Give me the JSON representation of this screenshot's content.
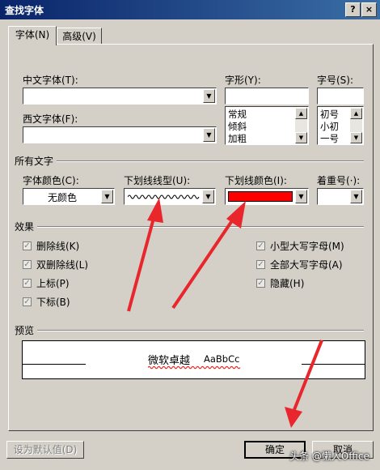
{
  "window": {
    "title": "查找字体",
    "help_btn": "?",
    "close_btn": "×"
  },
  "tabs": [
    {
      "label": "字体(N)"
    },
    {
      "label": "高级(V)"
    }
  ],
  "fonts": {
    "chinese_font_label": "中文字体(T):",
    "chinese_font_value": "",
    "western_font_label": "西文字体(F):",
    "western_font_value": "",
    "style_label": "字形(Y):",
    "style_value": "",
    "style_options": [
      "常规",
      "倾斜",
      "加粗"
    ],
    "size_label": "字号(S):",
    "size_value": "",
    "size_options": [
      "初号",
      "小初",
      "一号"
    ]
  },
  "all_text": {
    "group_label": "所有文字",
    "font_color_label": "字体颜色(C):",
    "font_color_value": "无颜色",
    "underline_type_label": "下划线线型(U):",
    "underline_color_label": "下划线颜色(I):",
    "underline_color": "#ff0000",
    "emphasis_label": "着重号(·):"
  },
  "effects": {
    "group_label": "效果",
    "left": [
      {
        "label": "删除线(K)",
        "checked": true
      },
      {
        "label": "双删除线(L)",
        "checked": true
      },
      {
        "label": "上标(P)",
        "checked": true
      },
      {
        "label": "下标(B)",
        "checked": true
      }
    ],
    "right": [
      {
        "label": "小型大写字母(M)",
        "checked": true
      },
      {
        "label": "全部大写字母(A)",
        "checked": true
      },
      {
        "label": "隐藏(H)",
        "checked": true
      }
    ]
  },
  "preview": {
    "group_label": "预览",
    "sample_cn": "微软卓越",
    "sample_en": "AaBbCc"
  },
  "buttons": {
    "default": "设为默认值(D)",
    "ok": "确定",
    "cancel": "取消"
  },
  "watermark": "头条 @懒人Office",
  "colors": {
    "annotation_arrow": "#e8262c",
    "title_bar": "#0a246a"
  }
}
